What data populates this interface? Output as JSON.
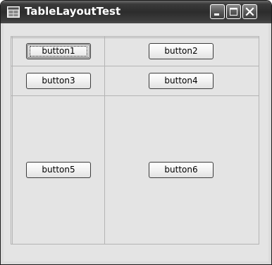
{
  "window": {
    "title": "TableLayoutTest",
    "icon": "app-window-icon",
    "controls": {
      "minimize_icon": "minimize-icon",
      "maximize_icon": "maximize-icon",
      "close_icon": "close-icon"
    }
  },
  "table": {
    "buttons": [
      {
        "label": "button1",
        "focused": true
      },
      {
        "label": "button2"
      },
      {
        "label": "button3"
      },
      {
        "label": "button4"
      },
      {
        "label": "button5"
      },
      {
        "label": "button6"
      }
    ]
  },
  "colors": {
    "titlebar": "#2c2c2c",
    "client": "#e4e4e4",
    "gridline": "#b4b4b4"
  }
}
